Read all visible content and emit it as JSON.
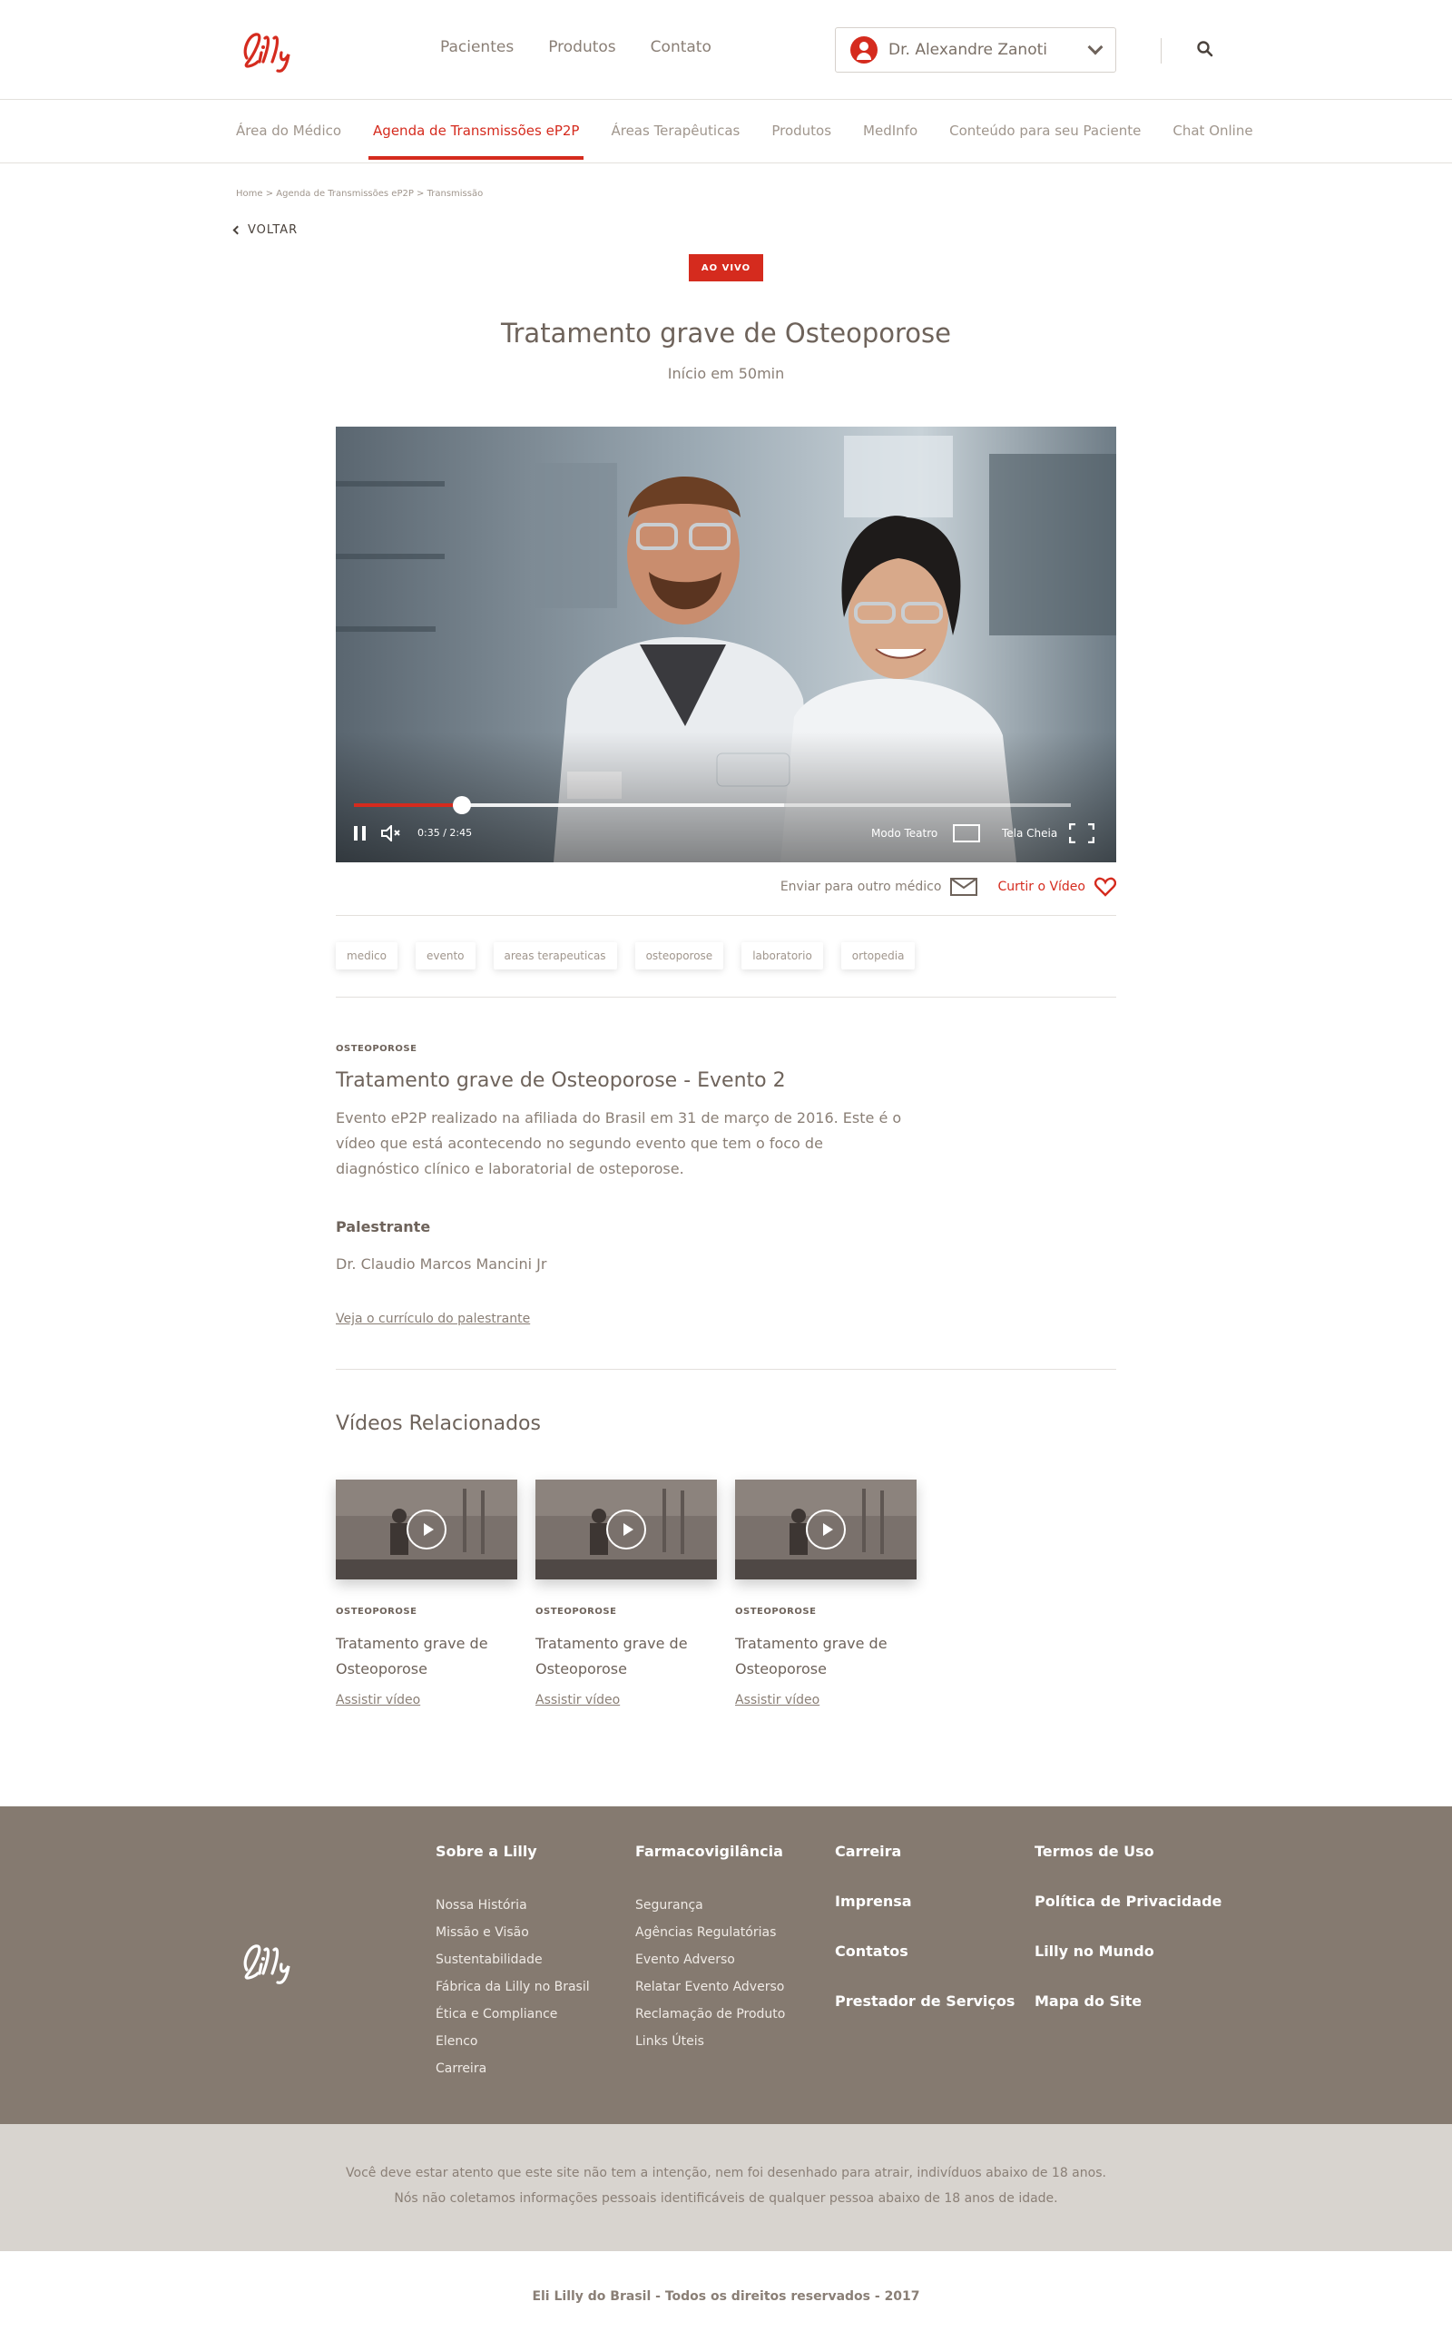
{
  "header": {
    "logo_text": "Lilly",
    "nav": [
      "Pacientes",
      "Produtos",
      "Contato"
    ],
    "user_name": "Dr. Alexandre Zanoti"
  },
  "subnav": {
    "items": [
      "Área do Médico",
      "Agenda de Transmissões eP2P",
      "Áreas Terapêuticas",
      "Produtos",
      "MedInfo",
      "Conteúdo para seu Paciente",
      "Chat Online"
    ],
    "active_index": 1
  },
  "breadcrumb": "Home > Agenda de Transmissões eP2P > Transmissão",
  "back_label": "VOLTAR",
  "live_badge": "AO VIVO",
  "title": "Tratamento grave de Osteoporose",
  "subtitle": "Início em 50min",
  "player": {
    "time": "0:35 / 2:45",
    "progress_fraction": 0.15,
    "buffer_fraction": 0.6,
    "theater_label": "Modo Teatro",
    "fullscreen_label": "Tela Cheia"
  },
  "actions": {
    "send_label": "Enviar para outro médico",
    "like_label": "Curtir o Vídeo"
  },
  "tags": [
    "medico",
    "evento",
    "areas terapeuticas",
    "osteoporose",
    "laboratorio",
    "ortopedia"
  ],
  "details": {
    "kicker": "OSTEOPOROSE",
    "title": "Tratamento grave de Osteoporose - Evento 2",
    "description": "Evento eP2P realizado na afiliada do Brasil em 31 de março de 2016. Este é o vídeo que está acontecendo no segundo evento que tem o foco de diagnóstico clínico e laboratorial de osteporose.",
    "speaker_heading": "Palestrante",
    "speaker_name": "Dr. Claudio Marcos Mancini Jr",
    "cv_link": "Veja o currículo do palestrante"
  },
  "related": {
    "heading": "Vídeos Relacionados",
    "videos": [
      {
        "kicker": "OSTEOPOROSE",
        "title": "Tratamento grave de Osteoporose",
        "link": "Assistir vídeo"
      },
      {
        "kicker": "OSTEOPOROSE",
        "title": "Tratamento grave de Osteoporose",
        "link": "Assistir vídeo"
      },
      {
        "kicker": "OSTEOPOROSE",
        "title": "Tratamento grave de Osteoporose",
        "link": "Assistir vídeo"
      }
    ]
  },
  "footer": {
    "col1": {
      "heading": "Sobre a Lilly",
      "links": [
        "Nossa História",
        "Missão e Visão",
        "Sustentabilidade",
        "Fábrica da Lilly no Brasil",
        "Ética e Compliance",
        "Elenco",
        "Carreira"
      ]
    },
    "col2": {
      "heading": "Farmacovigilância",
      "links": [
        "Segurança",
        "Agências Regulatórias",
        "Evento Adverso",
        "Relatar Evento Adverso",
        "Reclamação de Produto",
        "Links Úteis"
      ]
    },
    "col3": [
      "Carreira",
      "Imprensa",
      "Contatos",
      "Prestador de Serviços"
    ],
    "col4": [
      "Termos de Uso",
      "Política de Privacidade",
      "Lilly no Mundo",
      "Mapa do Site"
    ]
  },
  "disclaimer": [
    "Você deve estar atento que este site não tem a intenção, nem foi desenhado para atrair, indivíduos abaixo de 18 anos.",
    "Nós não coletamos informações pessoais identificáveis de qualquer pessoa abaixo de 18 anos de idade."
  ],
  "copyright": "Eli Lilly do Brasil - Todos os direitos reservados - 2017",
  "colors": {
    "brand_red": "#d52b1e",
    "footer_bg": "#857a70",
    "disclaimer_bg": "#d8d4cf"
  }
}
